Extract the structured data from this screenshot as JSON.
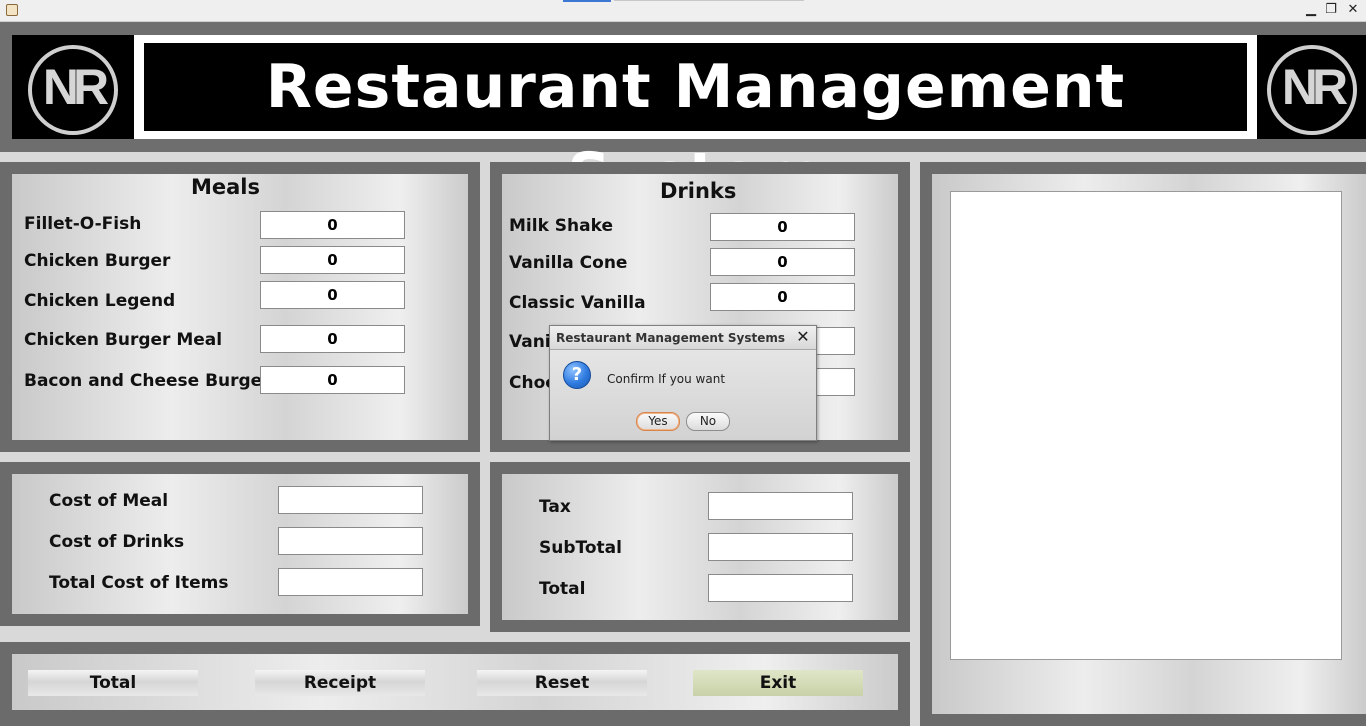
{
  "window": {
    "minimize": "▁",
    "maximize": "❐",
    "close": "✕"
  },
  "header": {
    "title": "Restaurant Management System",
    "logo_text": "NR"
  },
  "meals": {
    "heading": "Meals",
    "items": [
      {
        "label": "Fillet-O-Fish",
        "value": "0"
      },
      {
        "label": "Chicken Burger",
        "value": "0"
      },
      {
        "label": "Chicken Legend",
        "value": "0"
      },
      {
        "label": "Chicken Burger Meal",
        "value": "0"
      },
      {
        "label": "Bacon and Cheese Burger",
        "value": "0"
      }
    ]
  },
  "drinks": {
    "heading": "Drinks",
    "items": [
      {
        "label": "Milk Shake",
        "value": "0"
      },
      {
        "label": "Vanilla Cone",
        "value": "0"
      },
      {
        "label": "Classic Vanilla",
        "value": "0"
      },
      {
        "label": "Vani",
        "value": ""
      },
      {
        "label": "Choc",
        "value": ""
      }
    ]
  },
  "costs": {
    "cost_of_meal": {
      "label": "Cost of Meal",
      "value": ""
    },
    "cost_of_drinks": {
      "label": "Cost of Drinks",
      "value": ""
    },
    "total_cost_of_items": {
      "label": "Total Cost of Items",
      "value": ""
    }
  },
  "totals": {
    "tax": {
      "label": "Tax",
      "value": ""
    },
    "subtotal": {
      "label": "SubTotal",
      "value": ""
    },
    "total": {
      "label": "Total",
      "value": ""
    }
  },
  "receipt": {
    "text": ""
  },
  "buttons": {
    "total": "Total",
    "receipt": "Receipt",
    "reset": "Reset",
    "exit": "Exit"
  },
  "dialog": {
    "title": "Restaurant Management Systems",
    "message": "Confirm If you want",
    "yes": "Yes",
    "no": "No",
    "icon": "question-icon"
  }
}
